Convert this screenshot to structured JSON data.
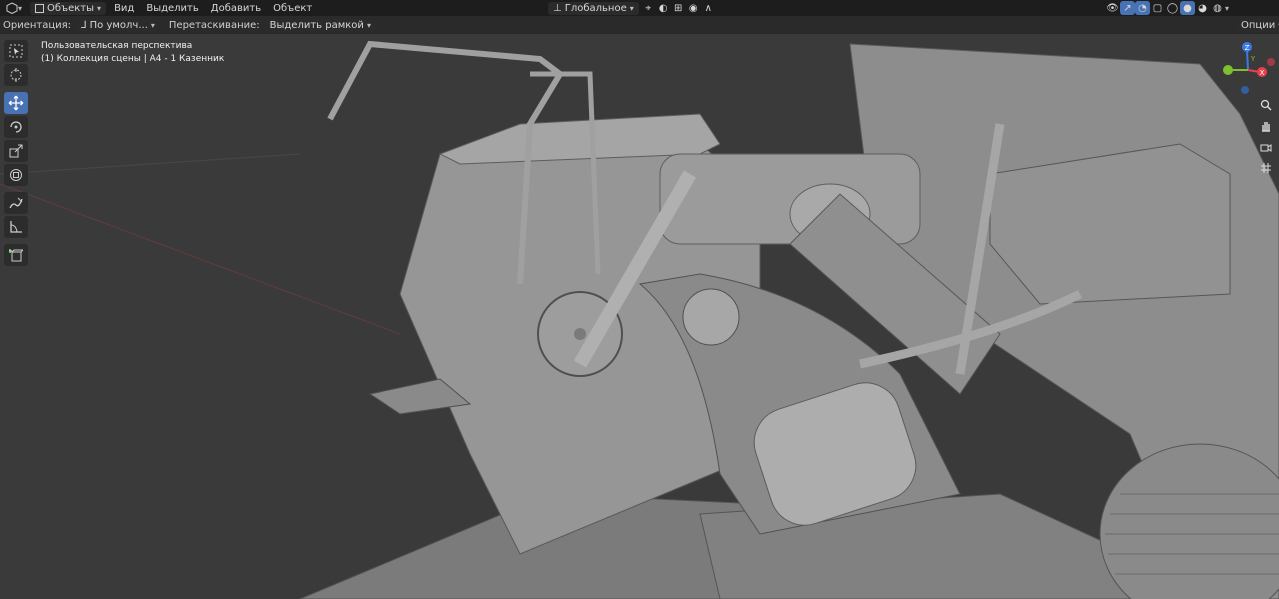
{
  "header": {
    "mode": "Объекты",
    "menus": [
      "Вид",
      "Выделить",
      "Добавить",
      "Объект"
    ],
    "transform_orientation": "Глобальное"
  },
  "tool_settings": {
    "orientation_label": "Ориентация:",
    "orientation_value": "По умолч...",
    "drag_label": "Перетаскивание:",
    "drag_value": "Выделить рамкой",
    "options_label": "Опции"
  },
  "viewport": {
    "view_name": "Пользовательская перспектива",
    "collection_info": "(1) Коллекция сцены | А4 - 1 Казенник"
  },
  "gizmo_axes": {
    "z": "Z",
    "y": "Y",
    "x": "X"
  },
  "colors": {
    "active_tool": "#4772b3",
    "axis_x": "#e8414b",
    "axis_y": "#7fbf2f",
    "axis_z": "#3a7ae8",
    "header_bg": "#1d1d1d",
    "viewport_bg": "#3a3a3a"
  },
  "icons": {
    "editor_type": "cube-icon",
    "toolbar": [
      "select-box-icon",
      "cursor-icon",
      "move-icon",
      "rotate-icon",
      "scale-icon",
      "transform-icon",
      "annotate-icon",
      "measure-icon",
      "add-cube-icon"
    ],
    "navigation": [
      "zoom-icon",
      "hand-pan-icon",
      "camera-icon",
      "grid-ortho-icon"
    ]
  }
}
